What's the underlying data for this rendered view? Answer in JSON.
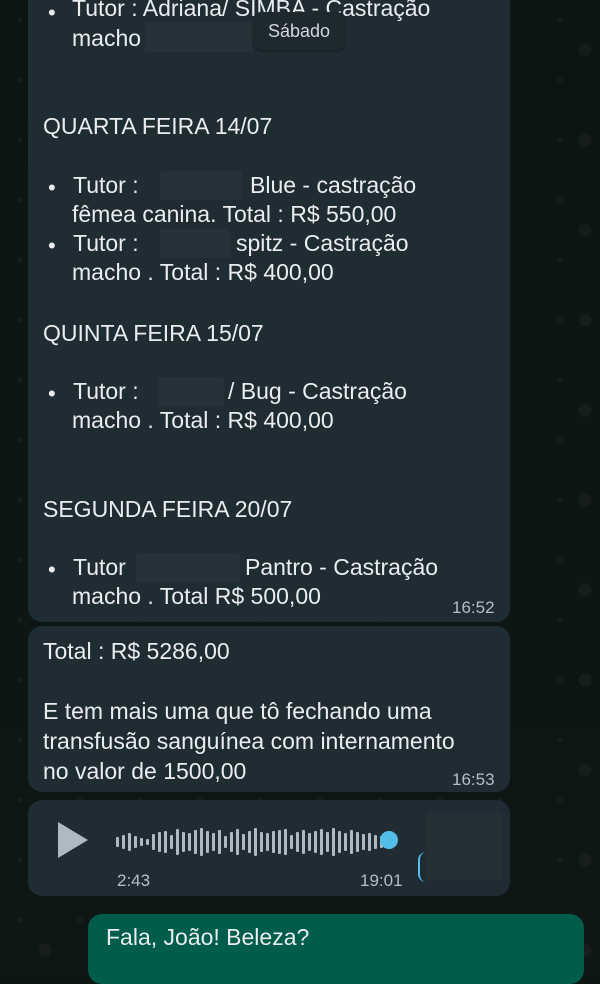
{
  "date_pill": "Sábado",
  "message1": {
    "top_line_partial": "Tutor : Adriana/ SIMBA - Castração",
    "top_line2": "macho",
    "sections": [
      {
        "heading": "QUARTA FEIRA 14/07",
        "items": [
          {
            "line1_prefix": "Tutor :",
            "line1_suffix": "Blue - castração",
            "line2": "fêmea canina. Total : R$ 550,00"
          },
          {
            "line1_prefix": "Tutor :",
            "line1_suffix": "spitz - Castração",
            "line2": "macho . Total : R$ 400,00"
          }
        ]
      },
      {
        "heading": "QUINTA FEIRA 15/07",
        "items": [
          {
            "line1_prefix": "Tutor :",
            "line1_suffix": "/ Bug - Castração",
            "line2": "macho . Total : R$ 400,00"
          }
        ]
      },
      {
        "heading": "SEGUNDA FEIRA 20/07",
        "items": [
          {
            "line1_prefix": "Tutor",
            "line1_suffix": "Pantro - Castração",
            "line2": "macho . Total  R$ 500,00"
          }
        ]
      }
    ],
    "time": "16:52"
  },
  "message2": {
    "total": "Total : R$ 5286,00",
    "lines": [
      "E tem mais uma que tô fechando uma",
      "transfusão sanguínea com internamento",
      "no valor de 1500,00"
    ],
    "time": "16:53"
  },
  "voice": {
    "duration": "2:43",
    "time": "19:01",
    "icons": {
      "play": "play-icon",
      "mic": "mic-icon"
    },
    "accent": "#53bdeb"
  },
  "outgoing": {
    "text": "Fala, João! Beleza?"
  },
  "colors": {
    "incoming_bubble": "#202c33",
    "outgoing_bubble": "#005c4b",
    "background": "#0e1614"
  }
}
